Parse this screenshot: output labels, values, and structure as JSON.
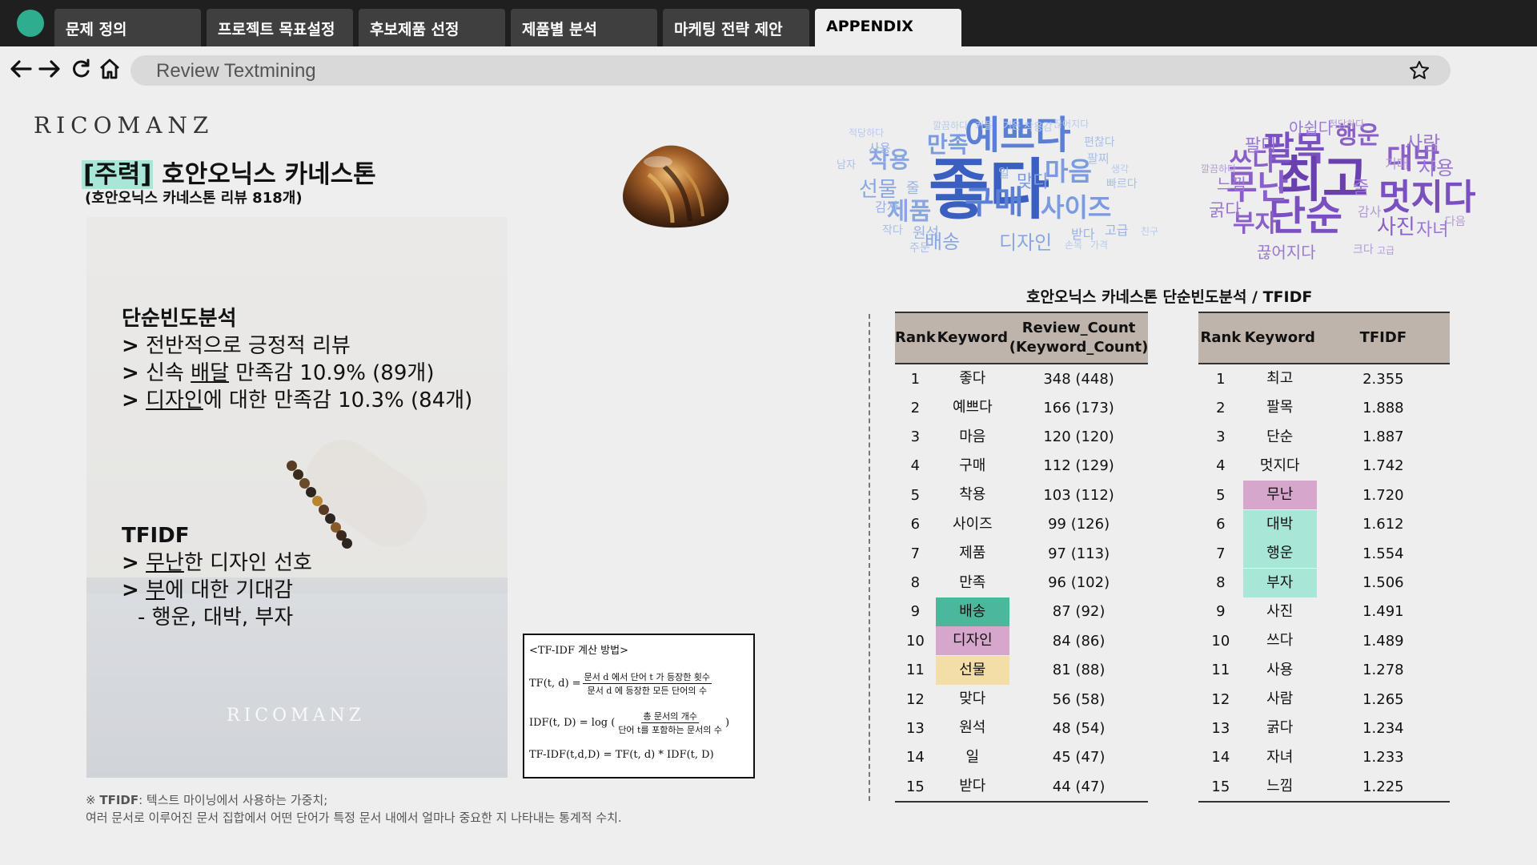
{
  "tabs": [
    {
      "label": "문제 정의",
      "active": false
    },
    {
      "label": "프로젝트 목표설정",
      "active": false
    },
    {
      "label": "후보제품 선정",
      "active": false
    },
    {
      "label": "제품별 분석",
      "active": false
    },
    {
      "label": "마케팅 전략 제안",
      "active": false
    },
    {
      "label": "APPENDIX",
      "active": true
    }
  ],
  "address": {
    "url": "Review Textmining"
  },
  "colors": {
    "accent": "#2eae8e",
    "teal_dark": "#4bb89b",
    "pink": "#d7a6cc",
    "beige": "#f2dea6",
    "teal_light": "#a8e6d8",
    "header_bg": "#beb4ac"
  },
  "brand": "RICOMANZ",
  "product": {
    "tag": "[주력]",
    "name": " 호안오닉스 카네스톤",
    "subtitle": "(호안오닉스 카네스톤 리뷰 818개)"
  },
  "analysis": {
    "freq_title": "단순빈도분석",
    "freq_line1": " 전반적으로 긍정적 리뷰",
    "freq_line2_pre": " 신속 ",
    "freq_line2_u": "배달",
    "freq_line2_post": " 만족감 10.9% (89개)",
    "freq_line3_u": "디자인",
    "freq_line3_post": "에 대한 만족감 10.3% (84개)",
    "tfidf_title": "TFIDF",
    "tfidf_line1_u": "무난",
    "tfidf_line1_post": "한 디자인 선호",
    "tfidf_line2_u": "부",
    "tfidf_line2_post": "에 대한 기대감",
    "tfidf_line3": "- 행운, 대박, 부자",
    "gt": ">"
  },
  "photo_brand": "RICOMANZ",
  "formula": {
    "title": "<TF-IDF 계산 방법>",
    "tf_lhs": "TF(t, d) =",
    "tf_num": "문서 d 에서 단어 t 가 등장한 횟수",
    "tf_den": "문서 d 에 등장한 모든 단어의 수",
    "idf_lhs": "IDF(t, D) = log (",
    "idf_num": "총 문서의 개수",
    "idf_den": "단어 t를 포함하는 문서의 수",
    "idf_close": ")",
    "tfidf": "TF-IDF(t,d,D) = TF(t, d) * IDF(t, D)"
  },
  "footnote": {
    "mark": "※ ",
    "term": "TFIDF",
    "line1_rest": ": 텍스트 마이닝에서 사용하는 가중치;",
    "line2": "여러 문서로 이루어진 문서 집합에서 어떤 단어가 특정 문서 내에서 얼마나 중요한 지 나타내는 통계적 수치."
  },
  "table_title": "호안오닉스 카네스톤 단순빈도분석 / TFIDF",
  "freq_table": {
    "headers": [
      "Rank",
      "Keyword",
      "Review_Count (Keyword_Count)"
    ],
    "rows": [
      {
        "rank": "1",
        "keyword": "좋다",
        "count": "348 (448)",
        "highlight": ""
      },
      {
        "rank": "2",
        "keyword": "예쁘다",
        "count": "166 (173)",
        "highlight": ""
      },
      {
        "rank": "3",
        "keyword": "마음",
        "count": "120 (120)",
        "highlight": ""
      },
      {
        "rank": "4",
        "keyword": "구매",
        "count": "112 (129)",
        "highlight": ""
      },
      {
        "rank": "5",
        "keyword": "착용",
        "count": "103 (112)",
        "highlight": ""
      },
      {
        "rank": "6",
        "keyword": "사이즈",
        "count": "99 (126)",
        "highlight": ""
      },
      {
        "rank": "7",
        "keyword": "제품",
        "count": "97 (113)",
        "highlight": ""
      },
      {
        "rank": "8",
        "keyword": "만족",
        "count": "96 (102)",
        "highlight": ""
      },
      {
        "rank": "9",
        "keyword": "배송",
        "count": "87 (92)",
        "highlight": "#4bb89b"
      },
      {
        "rank": "10",
        "keyword": "디자인",
        "count": "84 (86)",
        "highlight": "#d7a6cc"
      },
      {
        "rank": "11",
        "keyword": "선물",
        "count": "81 (88)",
        "highlight": "#f2dea6"
      },
      {
        "rank": "12",
        "keyword": "맞다",
        "count": "56 (58)",
        "highlight": ""
      },
      {
        "rank": "13",
        "keyword": "원석",
        "count": "48 (54)",
        "highlight": ""
      },
      {
        "rank": "14",
        "keyword": "일",
        "count": "45 (47)",
        "highlight": ""
      },
      {
        "rank": "15",
        "keyword": "받다",
        "count": "44 (47)",
        "highlight": ""
      }
    ]
  },
  "tfidf_table": {
    "headers": [
      "Rank",
      "Keyword",
      "TFIDF"
    ],
    "rows": [
      {
        "rank": "1",
        "keyword": "최고",
        "score": "2.355",
        "highlight": ""
      },
      {
        "rank": "2",
        "keyword": "팔목",
        "score": "1.888",
        "highlight": ""
      },
      {
        "rank": "3",
        "keyword": "단순",
        "score": "1.887",
        "highlight": ""
      },
      {
        "rank": "4",
        "keyword": "멋지다",
        "score": "1.742",
        "highlight": ""
      },
      {
        "rank": "5",
        "keyword": "무난",
        "score": "1.720",
        "highlight": "#d7a6cc"
      },
      {
        "rank": "6",
        "keyword": "대박",
        "score": "1.612",
        "highlight": "#a8e6d8"
      },
      {
        "rank": "7",
        "keyword": "행운",
        "score": "1.554",
        "highlight": "#a8e6d8"
      },
      {
        "rank": "8",
        "keyword": "부자",
        "score": "1.506",
        "highlight": "#a8e6d8"
      },
      {
        "rank": "9",
        "keyword": "사진",
        "score": "1.491",
        "highlight": ""
      },
      {
        "rank": "10",
        "keyword": "쓰다",
        "score": "1.489",
        "highlight": ""
      },
      {
        "rank": "11",
        "keyword": "사용",
        "score": "1.278",
        "highlight": ""
      },
      {
        "rank": "12",
        "keyword": "사람",
        "score": "1.265",
        "highlight": ""
      },
      {
        "rank": "13",
        "keyword": "굵다",
        "score": "1.234",
        "highlight": ""
      },
      {
        "rank": "14",
        "keyword": "자녀",
        "score": "1.233",
        "highlight": ""
      },
      {
        "rank": "15",
        "keyword": "느낌",
        "score": "1.225",
        "highlight": ""
      }
    ]
  },
  "wordcloud_freq": [
    {
      "text": "좋다",
      "color": "#3a5fc0"
    },
    {
      "text": "예쁘다",
      "color": "#5c7fd6"
    },
    {
      "text": "구매",
      "color": "#5c7fd6"
    },
    {
      "text": "마음",
      "color": "#7c9ae0"
    },
    {
      "text": "사이즈",
      "color": "#7c9ae0"
    },
    {
      "text": "만족",
      "color": "#7c9ae0"
    },
    {
      "text": "착용",
      "color": "#8aa6e2"
    },
    {
      "text": "선물",
      "color": "#8aa6e2"
    },
    {
      "text": "제품",
      "color": "#8aa6e2"
    },
    {
      "text": "배송",
      "color": "#8aa6e2"
    },
    {
      "text": "디자인",
      "color": "#8aa6e2"
    },
    {
      "text": "맞다",
      "color": "#7c9ae0"
    },
    {
      "text": "원석",
      "color": "#9ab3e6"
    },
    {
      "text": "받다",
      "color": "#9ab3e6"
    },
    {
      "text": "사용",
      "color": "#9ab3e6"
    },
    {
      "text": "감사",
      "color": "#9ab3e6"
    },
    {
      "text": "고급",
      "color": "#9ab3e6"
    },
    {
      "text": "일",
      "color": "#9ab3e6"
    },
    {
      "text": "줄",
      "color": "#9ab3e6"
    },
    {
      "text": "편찮다",
      "color": "#a9bfea"
    },
    {
      "text": "팔찌",
      "color": "#a9bfea"
    },
    {
      "text": "빠르다",
      "color": "#a9bfea"
    },
    {
      "text": "작다",
      "color": "#a9bfea"
    },
    {
      "text": "주문",
      "color": "#a9bfea"
    },
    {
      "text": "남자",
      "color": "#a9bfea"
    },
    {
      "text": "가격",
      "color": "#b8caee"
    },
    {
      "text": "손목",
      "color": "#b8caee"
    },
    {
      "text": "친구",
      "color": "#b8caee"
    },
    {
      "text": "생각",
      "color": "#b8caee"
    },
    {
      "text": "깔끔하다",
      "color": "#b8caee"
    },
    {
      "text": "커플",
      "color": "#b8caee"
    },
    {
      "text": "기운",
      "color": "#b8caee"
    },
    {
      "text": "끊어지다",
      "color": "#b8caee"
    },
    {
      "text": "착용감",
      "color": "#b8caee"
    },
    {
      "text": "적당하다",
      "color": "#b8caee"
    }
  ],
  "wordcloud_tfidf": [
    {
      "text": "최고",
      "color": "#6a3fb0"
    },
    {
      "text": "단순",
      "color": "#7a4fc0"
    },
    {
      "text": "팔목",
      "color": "#7a4fc0"
    },
    {
      "text": "멋지다",
      "color": "#7a4fc0"
    },
    {
      "text": "무난",
      "color": "#8a5fc8"
    },
    {
      "text": "대박",
      "color": "#8a5fc8"
    },
    {
      "text": "행운",
      "color": "#8a5fc8"
    },
    {
      "text": "부자",
      "color": "#8a5fc8"
    },
    {
      "text": "사진",
      "color": "#8a5fc8"
    },
    {
      "text": "쓰다",
      "color": "#8a5fc8"
    },
    {
      "text": "사람",
      "color": "#9a77d0"
    },
    {
      "text": "사용",
      "color": "#9a77d0"
    },
    {
      "text": "굵다",
      "color": "#9a77d0"
    },
    {
      "text": "자녀",
      "color": "#9a77d0"
    },
    {
      "text": "느낌",
      "color": "#9a77d0"
    },
    {
      "text": "아쉽다",
      "color": "#9a77d0"
    },
    {
      "text": "끊어지다",
      "color": "#9a77d0"
    },
    {
      "text": "팔다",
      "color": "#9a77d0"
    },
    {
      "text": "줄",
      "color": "#9a77d0"
    },
    {
      "text": "기대",
      "color": "#b39ad8"
    },
    {
      "text": "감사",
      "color": "#b39ad8"
    },
    {
      "text": "크다",
      "color": "#b39ad8"
    },
    {
      "text": "고급",
      "color": "#b39ad8"
    },
    {
      "text": "다음",
      "color": "#b39ad8"
    },
    {
      "text": "적당하다",
      "color": "#b39ad8"
    },
    {
      "text": "깔끔하다",
      "color": "#b39ad8"
    }
  ]
}
